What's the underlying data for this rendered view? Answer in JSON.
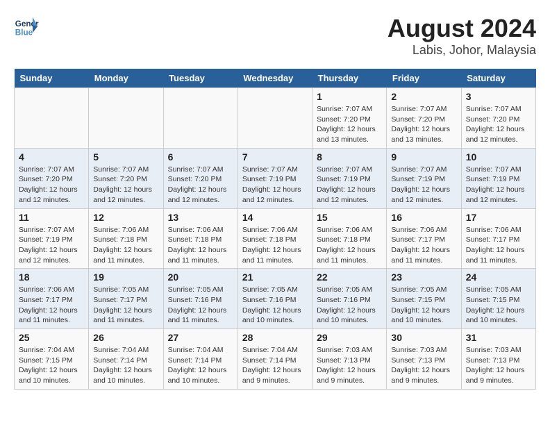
{
  "header": {
    "logo_line1": "General",
    "logo_line2": "Blue",
    "title": "August 2024",
    "subtitle": "Labis, Johor, Malaysia"
  },
  "days_of_week": [
    "Sunday",
    "Monday",
    "Tuesday",
    "Wednesday",
    "Thursday",
    "Friday",
    "Saturday"
  ],
  "weeks": [
    [
      {
        "day": "",
        "info": ""
      },
      {
        "day": "",
        "info": ""
      },
      {
        "day": "",
        "info": ""
      },
      {
        "day": "",
        "info": ""
      },
      {
        "day": "1",
        "info": "Sunrise: 7:07 AM\nSunset: 7:20 PM\nDaylight: 12 hours\nand 13 minutes."
      },
      {
        "day": "2",
        "info": "Sunrise: 7:07 AM\nSunset: 7:20 PM\nDaylight: 12 hours\nand 13 minutes."
      },
      {
        "day": "3",
        "info": "Sunrise: 7:07 AM\nSunset: 7:20 PM\nDaylight: 12 hours\nand 12 minutes."
      }
    ],
    [
      {
        "day": "4",
        "info": "Sunrise: 7:07 AM\nSunset: 7:20 PM\nDaylight: 12 hours\nand 12 minutes."
      },
      {
        "day": "5",
        "info": "Sunrise: 7:07 AM\nSunset: 7:20 PM\nDaylight: 12 hours\nand 12 minutes."
      },
      {
        "day": "6",
        "info": "Sunrise: 7:07 AM\nSunset: 7:20 PM\nDaylight: 12 hours\nand 12 minutes."
      },
      {
        "day": "7",
        "info": "Sunrise: 7:07 AM\nSunset: 7:19 PM\nDaylight: 12 hours\nand 12 minutes."
      },
      {
        "day": "8",
        "info": "Sunrise: 7:07 AM\nSunset: 7:19 PM\nDaylight: 12 hours\nand 12 minutes."
      },
      {
        "day": "9",
        "info": "Sunrise: 7:07 AM\nSunset: 7:19 PM\nDaylight: 12 hours\nand 12 minutes."
      },
      {
        "day": "10",
        "info": "Sunrise: 7:07 AM\nSunset: 7:19 PM\nDaylight: 12 hours\nand 12 minutes."
      }
    ],
    [
      {
        "day": "11",
        "info": "Sunrise: 7:07 AM\nSunset: 7:19 PM\nDaylight: 12 hours\nand 12 minutes."
      },
      {
        "day": "12",
        "info": "Sunrise: 7:06 AM\nSunset: 7:18 PM\nDaylight: 12 hours\nand 11 minutes."
      },
      {
        "day": "13",
        "info": "Sunrise: 7:06 AM\nSunset: 7:18 PM\nDaylight: 12 hours\nand 11 minutes."
      },
      {
        "day": "14",
        "info": "Sunrise: 7:06 AM\nSunset: 7:18 PM\nDaylight: 12 hours\nand 11 minutes."
      },
      {
        "day": "15",
        "info": "Sunrise: 7:06 AM\nSunset: 7:18 PM\nDaylight: 12 hours\nand 11 minutes."
      },
      {
        "day": "16",
        "info": "Sunrise: 7:06 AM\nSunset: 7:17 PM\nDaylight: 12 hours\nand 11 minutes."
      },
      {
        "day": "17",
        "info": "Sunrise: 7:06 AM\nSunset: 7:17 PM\nDaylight: 12 hours\nand 11 minutes."
      }
    ],
    [
      {
        "day": "18",
        "info": "Sunrise: 7:06 AM\nSunset: 7:17 PM\nDaylight: 12 hours\nand 11 minutes."
      },
      {
        "day": "19",
        "info": "Sunrise: 7:05 AM\nSunset: 7:17 PM\nDaylight: 12 hours\nand 11 minutes."
      },
      {
        "day": "20",
        "info": "Sunrise: 7:05 AM\nSunset: 7:16 PM\nDaylight: 12 hours\nand 11 minutes."
      },
      {
        "day": "21",
        "info": "Sunrise: 7:05 AM\nSunset: 7:16 PM\nDaylight: 12 hours\nand 10 minutes."
      },
      {
        "day": "22",
        "info": "Sunrise: 7:05 AM\nSunset: 7:16 PM\nDaylight: 12 hours\nand 10 minutes."
      },
      {
        "day": "23",
        "info": "Sunrise: 7:05 AM\nSunset: 7:15 PM\nDaylight: 12 hours\nand 10 minutes."
      },
      {
        "day": "24",
        "info": "Sunrise: 7:05 AM\nSunset: 7:15 PM\nDaylight: 12 hours\nand 10 minutes."
      }
    ],
    [
      {
        "day": "25",
        "info": "Sunrise: 7:04 AM\nSunset: 7:15 PM\nDaylight: 12 hours\nand 10 minutes."
      },
      {
        "day": "26",
        "info": "Sunrise: 7:04 AM\nSunset: 7:14 PM\nDaylight: 12 hours\nand 10 minutes."
      },
      {
        "day": "27",
        "info": "Sunrise: 7:04 AM\nSunset: 7:14 PM\nDaylight: 12 hours\nand 10 minutes."
      },
      {
        "day": "28",
        "info": "Sunrise: 7:04 AM\nSunset: 7:14 PM\nDaylight: 12 hours\nand 9 minutes."
      },
      {
        "day": "29",
        "info": "Sunrise: 7:03 AM\nSunset: 7:13 PM\nDaylight: 12 hours\nand 9 minutes."
      },
      {
        "day": "30",
        "info": "Sunrise: 7:03 AM\nSunset: 7:13 PM\nDaylight: 12 hours\nand 9 minutes."
      },
      {
        "day": "31",
        "info": "Sunrise: 7:03 AM\nSunset: 7:13 PM\nDaylight: 12 hours\nand 9 minutes."
      }
    ]
  ]
}
